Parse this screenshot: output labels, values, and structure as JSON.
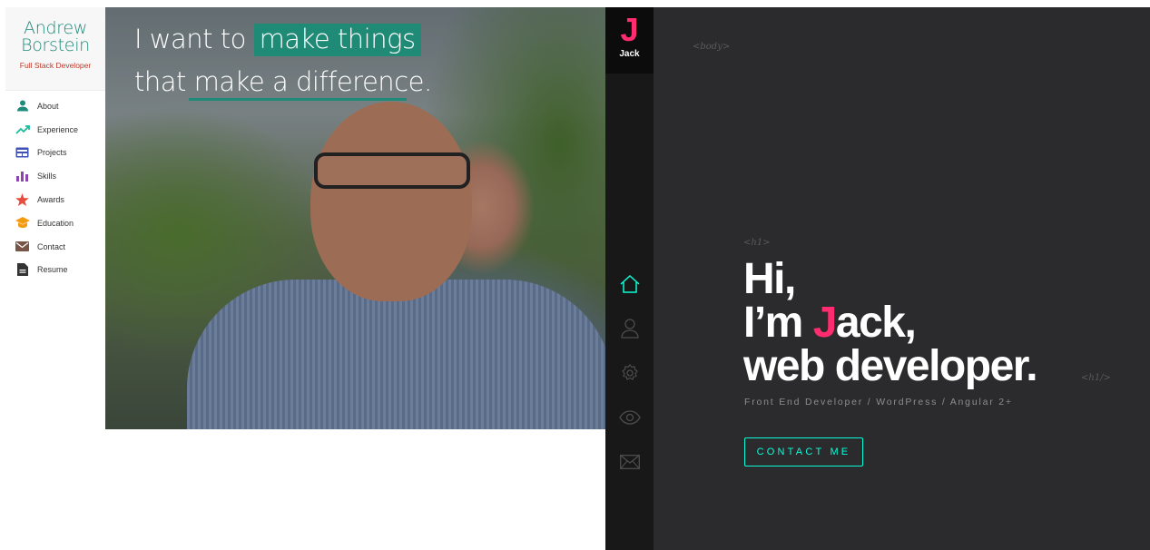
{
  "left_portfolio": {
    "name_line1": "Andrew",
    "name_line2": "Borstein",
    "role": "Full Stack Developer",
    "nav": [
      {
        "label": "About",
        "icon": "person-icon",
        "color": "#1d8a7a"
      },
      {
        "label": "Experience",
        "icon": "trending-icon",
        "color": "#1abc9c"
      },
      {
        "label": "Projects",
        "icon": "projects-icon",
        "color": "#3f51b5"
      },
      {
        "label": "Skills",
        "icon": "bar-chart-icon",
        "color": "#8e44ad"
      },
      {
        "label": "Awards",
        "icon": "star-icon",
        "color": "#e74c3c"
      },
      {
        "label": "Education",
        "icon": "graduation-cap-icon",
        "color": "#f39c12"
      },
      {
        "label": "Contact",
        "icon": "mail-icon",
        "color": "#795548"
      },
      {
        "label": "Resume",
        "icon": "document-icon",
        "color": "#333333"
      }
    ],
    "headline": {
      "line1_plain": "I want to",
      "line1_highlight": "make things",
      "line2": "that make a difference."
    },
    "accent_color": "#1f8a75"
  },
  "right_portfolio": {
    "logo_letter": "J",
    "logo_name": "Jack",
    "nav_icons": [
      "home-icon",
      "user-icon",
      "settings-icon",
      "eye-icon",
      "mail-icon"
    ],
    "body_tag": "<body>",
    "h1_open_tag": "<h1>",
    "h1_close_tag": "<h1/>",
    "greeting": {
      "line1": "Hi,",
      "line2_prefix": "I’m ",
      "line2_highlight": "J",
      "line2_suffix": "ack,",
      "line3": "web developer."
    },
    "subline": "Front End Developer / WordPress / Angular 2+",
    "contact_label": "CONTACT ME",
    "accent_colors": {
      "teal": "#08fdd8",
      "pink": "#ff2d6f",
      "background": "#2b2b2d"
    }
  }
}
